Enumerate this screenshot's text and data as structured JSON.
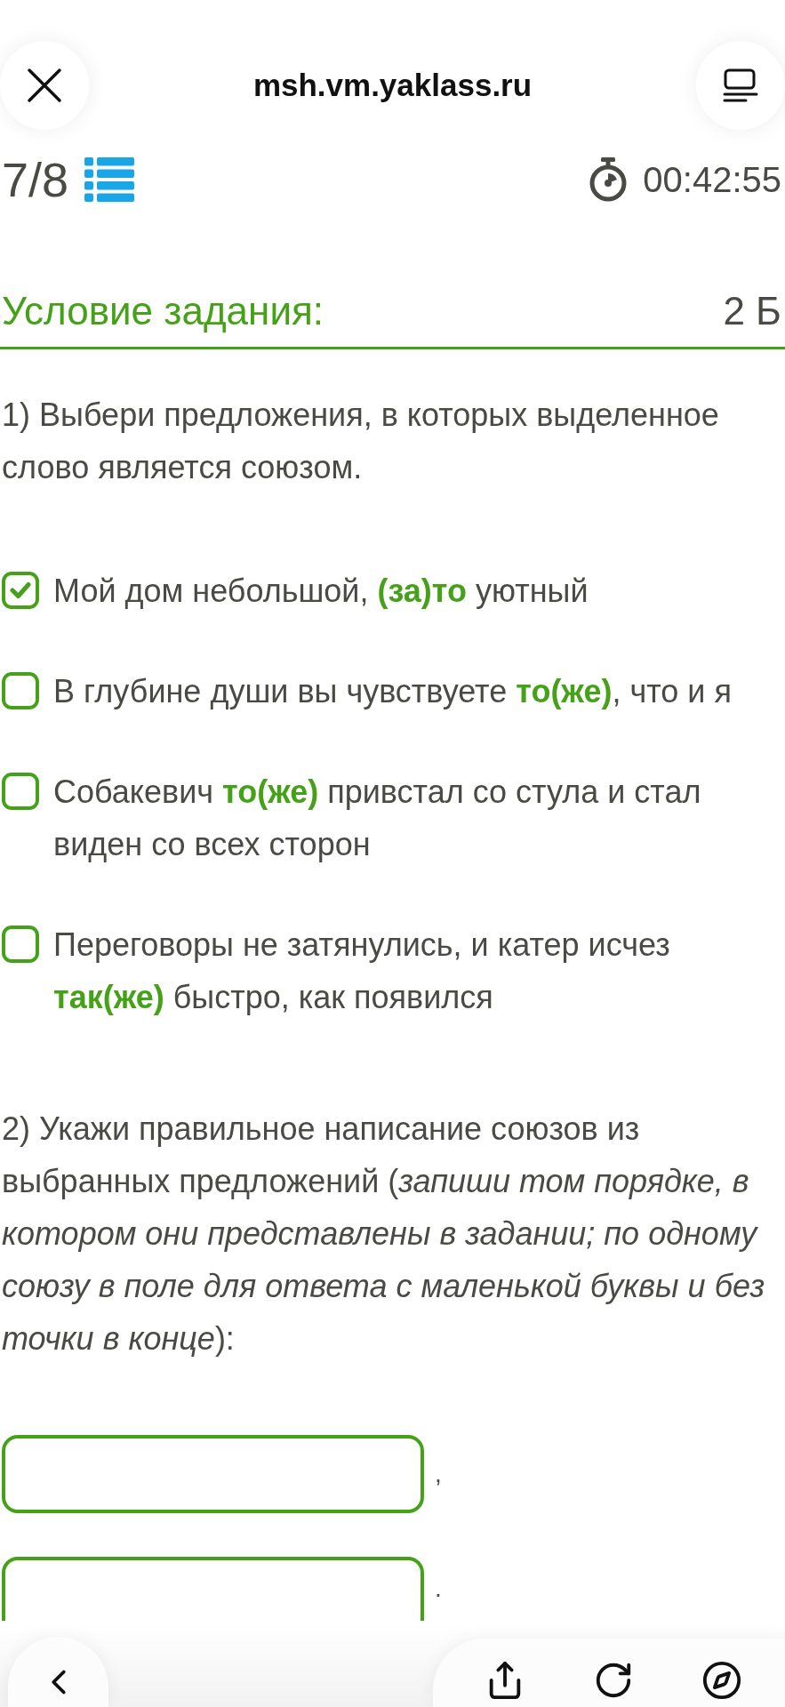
{
  "browser_bar": {
    "url": "msh.vm.yaklass.ru"
  },
  "progress": {
    "counter": "7/8",
    "timer": "00:42:55"
  },
  "task": {
    "heading": "Условие задания:",
    "points": "2 Б"
  },
  "part_1": {
    "prompt": "1) Выбери предложения, в которых выделенное слово является союзом.",
    "options": [
      {
        "text": "Мой дом небольшой, **(за)то** уютный",
        "checked": true
      },
      {
        "text": "В глубине души вы чувствуете **то(же)**, что и я",
        "checked": false
      },
      {
        "text": "Собакевич **то(же)** привстал со стула и стал виден со всех сторон",
        "checked": false
      },
      {
        "text": "Переговоры не затянулись, и катер исчез **так(же)** быстро, как появился",
        "checked": false
      }
    ]
  },
  "part_2": {
    "prompt": "2) Укажи правильное написание союзов из выбранных предложений (*запиши том порядке, в котором они представлены в задании; по одному союзу в поле для ответа с маленькой буквы и без точки в конце*):",
    "answers": [
      {
        "separator": ","
      },
      {
        "separator": "."
      }
    ]
  }
}
